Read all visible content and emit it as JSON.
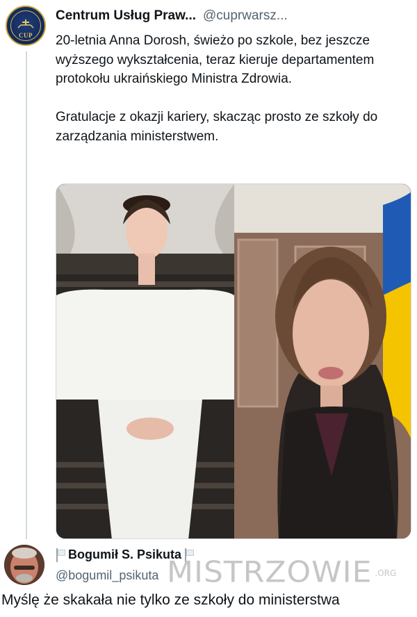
{
  "tweet": {
    "author_name": "Centrum Usług Praw...",
    "author_handle": "@cuprwarsz...",
    "avatar_icon": "organization-seal-icon",
    "avatar_text": "CUP",
    "text": "20-letnia Anna Dorosh, świeżo po szkole, bez jeszcze wyższego wykształcenia, teraz kieruje departamentem protokołu ukraińskiego Ministra Zdrowia.\n\nGratulacje z okazji kariery, skacząc prosto ze szkoły do zarządzania ministerstwem."
  },
  "reply": {
    "author_name": "Bogumił S. Psikuta",
    "author_handle": "@bogumil_psikuta",
    "name_icons": [
      "flag-icon",
      "flag-icon"
    ],
    "text": "Myślę że skakała nie tylko ze szkoły do ministerstwa"
  },
  "watermark": {
    "main": "MISTRZOWIE",
    "suffix": ".ORG"
  },
  "colors": {
    "text": "#0f1419",
    "secondary": "#536471",
    "border": "#cfd9de",
    "flag_blue": "#1f5bb5",
    "flag_yellow": "#f5c400"
  }
}
